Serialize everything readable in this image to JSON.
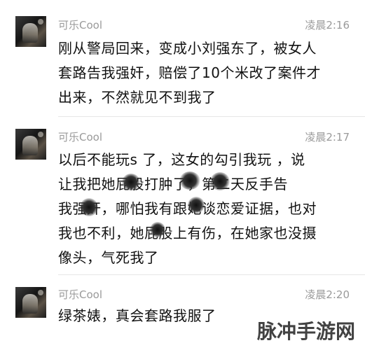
{
  "messages": [
    {
      "username": "可乐Cool",
      "time": "凌晨2:16",
      "lines": [
        "刚从警局回来，变成小刘强东了，被女人",
        "套路告我强奸，赔偿了10个米改了案件才",
        "出来，不然就见不到我了"
      ]
    },
    {
      "username": "可乐Cool",
      "time": "凌晨2:17",
      "lines": [
        "以后不能玩s    了，这女的勾引我玩   ，说",
        "让我把她屁股打肿了，第二天反手告",
        "我强奸，哪怕我有跟她谈恋爱证据，也对",
        "我也不利，她屁股上有伤，在她家也没摄",
        "像头，气死我了"
      ]
    },
    {
      "username": "可乐Cool",
      "time": "凌晨2:20",
      "lines": [
        "绿茶婊，真会套路我服了"
      ]
    }
  ],
  "watermark": "脉冲手游网"
}
